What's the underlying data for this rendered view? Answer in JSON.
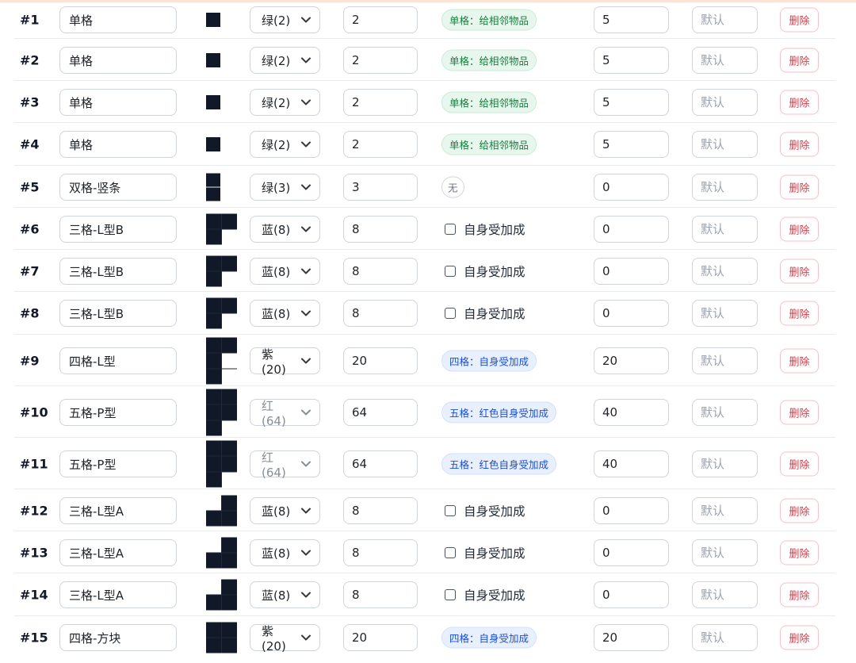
{
  "rows": [
    {
      "idx": "#1",
      "name": "单格",
      "shape": {
        "cols": 1,
        "cells": [
          1
        ]
      },
      "color": "绿(2)",
      "color_dim": false,
      "count": "2",
      "effect": {
        "type": "badge",
        "tone": "green",
        "text": "单格：给相邻物品"
      },
      "value": "5",
      "default_placeholder": "默认",
      "delete": "删除"
    },
    {
      "idx": "#2",
      "name": "单格",
      "shape": {
        "cols": 1,
        "cells": [
          1
        ]
      },
      "color": "绿(2)",
      "color_dim": false,
      "count": "2",
      "effect": {
        "type": "badge",
        "tone": "green",
        "text": "单格：给相邻物品"
      },
      "value": "5",
      "default_placeholder": "默认",
      "delete": "删除"
    },
    {
      "idx": "#3",
      "name": "单格",
      "shape": {
        "cols": 1,
        "cells": [
          1
        ]
      },
      "color": "绿(2)",
      "color_dim": false,
      "count": "2",
      "effect": {
        "type": "badge",
        "tone": "green",
        "text": "单格：给相邻物品"
      },
      "value": "5",
      "default_placeholder": "默认",
      "delete": "删除"
    },
    {
      "idx": "#4",
      "name": "单格",
      "shape": {
        "cols": 1,
        "cells": [
          1
        ]
      },
      "color": "绿(2)",
      "color_dim": false,
      "count": "2",
      "effect": {
        "type": "badge",
        "tone": "green",
        "text": "单格：给相邻物品"
      },
      "value": "5",
      "default_placeholder": "默认",
      "delete": "删除"
    },
    {
      "idx": "#5",
      "name": "双格-竖条",
      "shape": {
        "cols": 1,
        "cells": [
          1,
          1
        ]
      },
      "color": "绿(3)",
      "color_dim": false,
      "count": "3",
      "effect": {
        "type": "badge",
        "tone": "gray",
        "text": "无"
      },
      "value": "0",
      "default_placeholder": "默认",
      "delete": "删除"
    },
    {
      "idx": "#6",
      "name": "三格-L型B",
      "shape": {
        "cols": 2,
        "cells": [
          1,
          1,
          1,
          0
        ]
      },
      "color": "蓝(8)",
      "color_dim": false,
      "count": "8",
      "effect": {
        "type": "checkbox",
        "text": "自身受加成"
      },
      "value": "0",
      "default_placeholder": "默认",
      "delete": "删除"
    },
    {
      "idx": "#7",
      "name": "三格-L型B",
      "shape": {
        "cols": 2,
        "cells": [
          1,
          1,
          1,
          0
        ]
      },
      "color": "蓝(8)",
      "color_dim": false,
      "count": "8",
      "effect": {
        "type": "checkbox",
        "text": "自身受加成"
      },
      "value": "0",
      "default_placeholder": "默认",
      "delete": "删除"
    },
    {
      "idx": "#8",
      "name": "三格-L型B",
      "shape": {
        "cols": 2,
        "cells": [
          1,
          1,
          1,
          0
        ]
      },
      "color": "蓝(8)",
      "color_dim": false,
      "count": "8",
      "effect": {
        "type": "checkbox",
        "text": "自身受加成"
      },
      "value": "0",
      "default_placeholder": "默认",
      "delete": "删除"
    },
    {
      "idx": "#9",
      "name": "四格-L型",
      "shape": {
        "cols": 2,
        "cells": [
          1,
          1,
          1,
          0,
          1,
          0
        ]
      },
      "color": "紫(20)",
      "color_dim": false,
      "count": "20",
      "effect": {
        "type": "badge",
        "tone": "blue",
        "text": "四格：自身受加成"
      },
      "value": "20",
      "default_placeholder": "默认",
      "delete": "删除"
    },
    {
      "idx": "#10",
      "name": "五格-P型",
      "shape": {
        "cols": 2,
        "cells": [
          1,
          1,
          1,
          1,
          1,
          0
        ]
      },
      "color": "红(64)",
      "color_dim": true,
      "count": "64",
      "effect": {
        "type": "badge",
        "tone": "blue",
        "text": "五格：红色自身受加成"
      },
      "value": "40",
      "default_placeholder": "默认",
      "delete": "删除"
    },
    {
      "idx": "#11",
      "name": "五格-P型",
      "shape": {
        "cols": 2,
        "cells": [
          1,
          1,
          1,
          1,
          1,
          0
        ]
      },
      "color": "红(64)",
      "color_dim": true,
      "count": "64",
      "effect": {
        "type": "badge",
        "tone": "blue",
        "text": "五格：红色自身受加成"
      },
      "value": "40",
      "default_placeholder": "默认",
      "delete": "删除"
    },
    {
      "idx": "#12",
      "name": "三格-L型A",
      "shape": {
        "cols": 2,
        "cells": [
          0,
          1,
          1,
          1
        ]
      },
      "color": "蓝(8)",
      "color_dim": false,
      "count": "8",
      "effect": {
        "type": "checkbox",
        "text": "自身受加成"
      },
      "value": "0",
      "default_placeholder": "默认",
      "delete": "删除"
    },
    {
      "idx": "#13",
      "name": "三格-L型A",
      "shape": {
        "cols": 2,
        "cells": [
          0,
          1,
          1,
          1
        ]
      },
      "color": "蓝(8)",
      "color_dim": false,
      "count": "8",
      "effect": {
        "type": "checkbox",
        "text": "自身受加成"
      },
      "value": "0",
      "default_placeholder": "默认",
      "delete": "删除"
    },
    {
      "idx": "#14",
      "name": "三格-L型A",
      "shape": {
        "cols": 2,
        "cells": [
          0,
          1,
          1,
          1
        ]
      },
      "color": "蓝(8)",
      "color_dim": false,
      "count": "8",
      "effect": {
        "type": "checkbox",
        "text": "自身受加成"
      },
      "value": "0",
      "default_placeholder": "默认",
      "delete": "删除"
    },
    {
      "idx": "#15",
      "name": "四格-方块",
      "shape": {
        "cols": 2,
        "cells": [
          1,
          1,
          1,
          1
        ]
      },
      "color": "紫(20)",
      "color_dim": false,
      "count": "20",
      "effect": {
        "type": "badge",
        "tone": "blue",
        "text": "四格：自身受加成"
      },
      "value": "20",
      "default_placeholder": "默认",
      "delete": "删除"
    }
  ]
}
